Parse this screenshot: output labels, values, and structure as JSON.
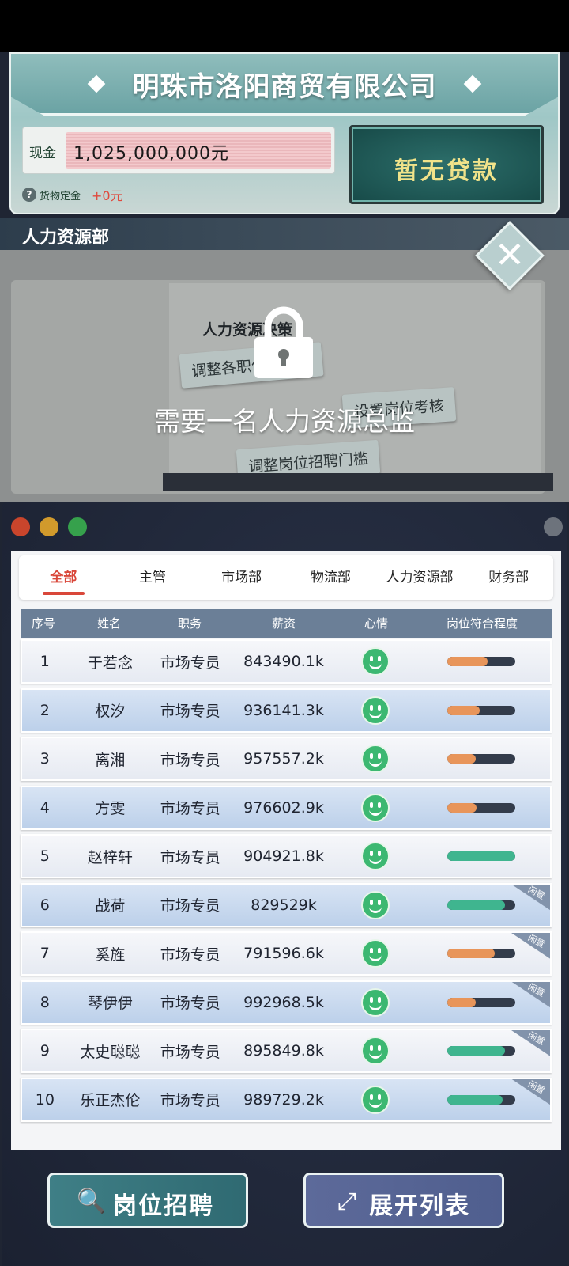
{
  "company": {
    "name": "明珠市洛阳商贸有限公司",
    "cash_label": "现金",
    "cash_value": "1,025,000,000元",
    "deposit_label": "货物定金",
    "deposit_value": "+0元",
    "loan_button": "暂无贷款"
  },
  "department": {
    "title": "人力资源部"
  },
  "hr_locked": {
    "board_title": "人力资源决策",
    "note1": "调整各职位薪幅度",
    "note2": "设置岗位考核",
    "note3": "调整岗位招聘门槛",
    "lock_message": "需要一名人力资源总监"
  },
  "tabs": [
    "全部",
    "主管",
    "市场部",
    "物流部",
    "人力资源部",
    "财务部"
  ],
  "active_tab": 0,
  "table": {
    "headers": [
      "序号",
      "姓名",
      "职务",
      "薪资",
      "心情",
      "岗位符合程度"
    ],
    "idle_label": "闲置",
    "rows": [
      {
        "no": "1",
        "name": "于若念",
        "title": "市场专员",
        "salary": "843490.1k",
        "fit": 0.6,
        "fit_color": "#e8955a",
        "idle": false
      },
      {
        "no": "2",
        "name": "权汐",
        "title": "市场专员",
        "salary": "936141.3k",
        "fit": 0.48,
        "fit_color": "#e8955a",
        "idle": false
      },
      {
        "no": "3",
        "name": "离湘",
        "title": "市场专员",
        "salary": "957557.2k",
        "fit": 0.42,
        "fit_color": "#e8955a",
        "idle": false
      },
      {
        "no": "4",
        "name": "方雯",
        "title": "市场专员",
        "salary": "976602.9k",
        "fit": 0.44,
        "fit_color": "#e8955a",
        "idle": false
      },
      {
        "no": "5",
        "name": "赵梓轩",
        "title": "市场专员",
        "salary": "904921.8k",
        "fit": 1.0,
        "fit_color": "#3fb58f",
        "idle": false
      },
      {
        "no": "6",
        "name": "战荷",
        "title": "市场专员",
        "salary": "829529k",
        "fit": 0.86,
        "fit_color": "#3fb58f",
        "idle": true
      },
      {
        "no": "7",
        "name": "奚旌",
        "title": "市场专员",
        "salary": "791596.6k",
        "fit": 0.7,
        "fit_color": "#e8955a",
        "idle": true
      },
      {
        "no": "8",
        "name": "琴伊伊",
        "title": "市场专员",
        "salary": "992968.5k",
        "fit": 0.42,
        "fit_color": "#e8955a",
        "idle": true
      },
      {
        "no": "9",
        "name": "太史聪聪",
        "title": "市场专员",
        "salary": "895849.8k",
        "fit": 0.86,
        "fit_color": "#3fb58f",
        "idle": true
      },
      {
        "no": "10",
        "name": "乐正杰伦",
        "title": "市场专员",
        "salary": "989729.2k",
        "fit": 0.82,
        "fit_color": "#3fb58f",
        "idle": true
      }
    ]
  },
  "buttons": {
    "recruit": "岗位招聘",
    "expand": "展开列表"
  }
}
